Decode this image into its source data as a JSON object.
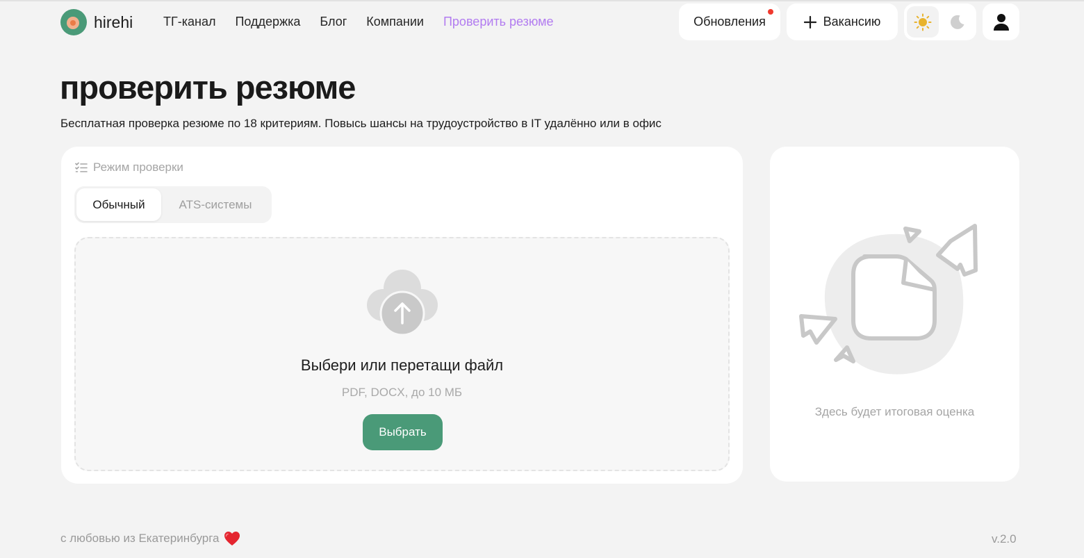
{
  "header": {
    "logo_text": "hirehi",
    "nav": [
      {
        "label": "ТГ-канал",
        "active": false
      },
      {
        "label": "Поддержка",
        "active": false
      },
      {
        "label": "Блог",
        "active": false
      },
      {
        "label": "Компании",
        "active": false
      },
      {
        "label": "Проверить резюме",
        "active": true
      }
    ],
    "updates_label": "Обновления",
    "updates_has_notification": true,
    "vacancy_label": "Вакансию",
    "theme": {
      "selected": "light",
      "icons": [
        "sun-icon",
        "moon-icon"
      ]
    },
    "profile_icon": "user-icon"
  },
  "page": {
    "title": "проверить резюме",
    "subtitle": "Бесплатная проверка резюме по 18 критериям. Повысь шансы на трудоустройство в IT удалённо или в офис"
  },
  "mode": {
    "label": "Режим проверки",
    "options": [
      {
        "label": "Обычный",
        "selected": true
      },
      {
        "label": "ATS-системы",
        "selected": false
      }
    ]
  },
  "upload": {
    "icon": "cloud-upload-icon",
    "title": "Выбери или перетащи файл",
    "hint": "PDF, DOCX, до 10 МБ",
    "button": "Выбрать"
  },
  "result": {
    "illustration": "document-with-paper-planes-icon",
    "placeholder": "Здесь будет итоговая оценка"
  },
  "footer": {
    "left": "с любовью из Екатеринбурга",
    "heart_icon": "heart-icon",
    "version": "v.2.0"
  },
  "colors": {
    "accent_green": "#4a9a78",
    "active_nav": "#b27cf0",
    "notification_dot": "#f0392e",
    "background": "#f3f3f3"
  }
}
